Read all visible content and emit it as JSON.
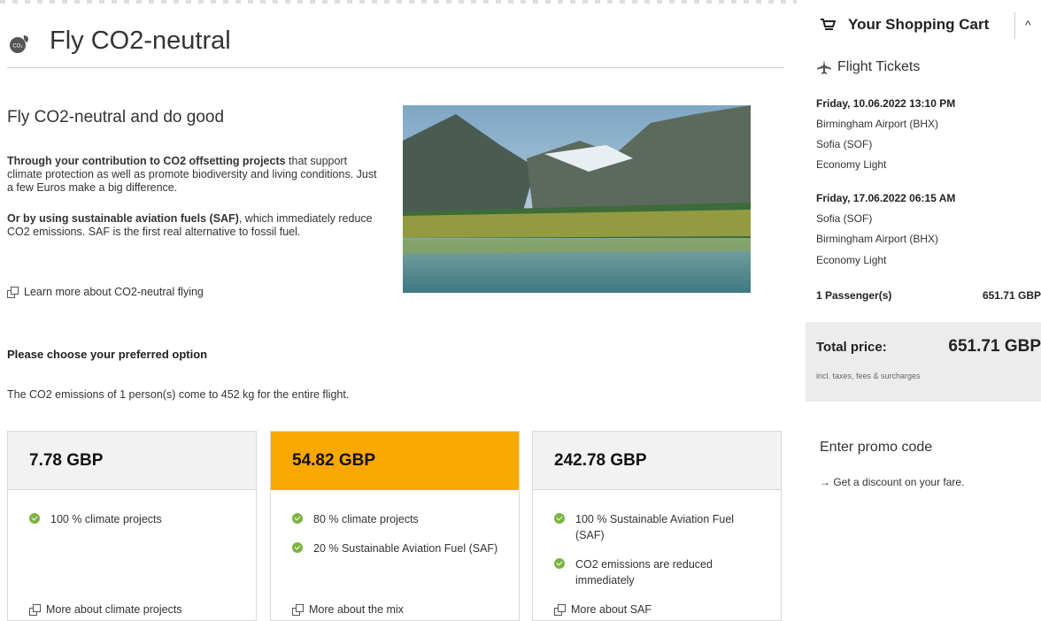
{
  "page": {
    "title": "Fly CO2-neutral",
    "intro_heading": "Fly CO2-neutral and do good",
    "para1_bold": "Through your contribution to CO2 offsetting projects",
    "para1_rest": " that support climate protection as well as promote biodiversity and living conditions. Just a few Euros make a big difference.",
    "para2_bold": "Or by using sustainable aviation fuels (SAF)",
    "para2_rest": ", which immediately reduce CO2 emissions. SAF is the first real alternative to fossil fuel.",
    "learn_more_link": "Learn more about CO2-neutral flying",
    "choose_heading": "Please choose your preferred option",
    "emissions_text": "The CO2 emissions of 1 person(s) come to 452 kg for the entire flight."
  },
  "options": [
    {
      "price": "7.78 GBP",
      "selected": false,
      "features": [
        "100 % climate projects"
      ],
      "link": "More about climate projects"
    },
    {
      "price": "54.82 GBP",
      "selected": true,
      "features": [
        "80 % climate projects",
        "20 % Sustainable Aviation Fuel (SAF)"
      ],
      "link": "More about the mix"
    },
    {
      "price": "242.78 GBP",
      "selected": false,
      "features": [
        "100 % Sustainable Aviation Fuel (SAF)",
        "CO2 emissions are reduced immediately"
      ],
      "link": "More about SAF"
    }
  ],
  "cart": {
    "title": "Your Shopping Cart",
    "section_label": "Flight Tickets",
    "outbound": {
      "datetime": "Friday, 10.06.2022 13:10 PM",
      "from": "Birmingham Airport (BHX)",
      "to": "Sofia (SOF)",
      "fare": "Economy Light"
    },
    "return": {
      "datetime": "Friday, 17.06.2022 06:15 AM",
      "from": "Sofia (SOF)",
      "to": "Birmingham Airport (BHX)",
      "fare": "Economy Light"
    },
    "passengers_label": "1 Passenger(s)",
    "passengers_price": "651.71 GBP",
    "total_label": "Total price:",
    "total_value": "651.71 GBP",
    "total_note": "incl. taxes, fees & surcharges"
  },
  "promo": {
    "heading": "Enter promo code",
    "link": "→ Get a discount on your fare."
  },
  "colors": {
    "selected_option": "#f9a800",
    "check": "#7cb342",
    "total_box": "#ececec"
  }
}
